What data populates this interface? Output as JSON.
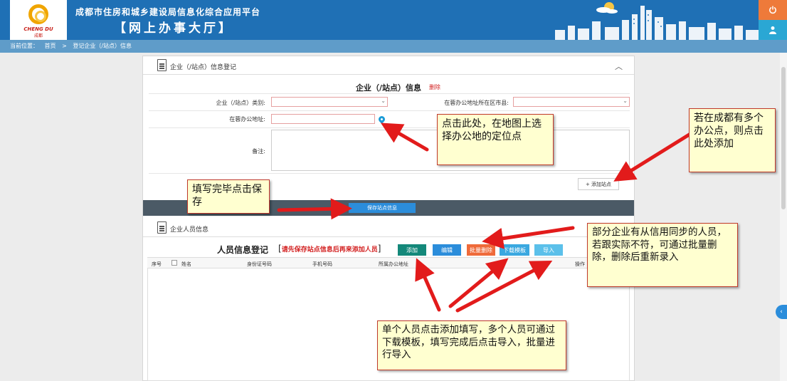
{
  "header": {
    "logo_en": "CHENG DU",
    "logo_cn": "成都",
    "title_line1": "成都市住房和城乡建设局信息化综合应用平台",
    "title_line2": "【网上办事大厅】"
  },
  "breadcrumb": {
    "prefix": "当前位置：",
    "home": "首页",
    "separator": ">",
    "current": "登记企业（/站点）信息"
  },
  "site_section": {
    "heading": "企业（/站点）信息登记",
    "form_title": "企业（/站点）信息",
    "delete_label": "删除",
    "type_label": "企业（/站点）类别:",
    "district_label": "在蓉办公地址所在区市县:",
    "address_label": "在蓉办公地址:",
    "remark_label": "备注:",
    "add_site_label": "+ 添加站点",
    "save_label": "保存站点信息"
  },
  "staff_section": {
    "heading": "企业人员信息",
    "title": "人员信息登记",
    "note_open": "[",
    "note_text": "请先保存站点信息后再来添加人员",
    "note_close": "]",
    "buttons": {
      "add": "添加",
      "edit": "编辑",
      "batch_delete": "批量删除",
      "download_template": "下载模板",
      "import": "导入"
    },
    "columns": {
      "index": "序号",
      "name": "姓名",
      "id_number": "身份证号码",
      "phone": "手机号码",
      "office_address": "所属办公地址",
      "action": "操作"
    }
  },
  "annotations": {
    "map_tip": "点击此处，在地图上选择办公地的定位点",
    "add_site_tip": "若在成都有多个办公点，则点击此处添加",
    "save_tip": "填写完毕点击保存",
    "sync_tip": "部分企业有从信用同步的人员，若跟实际不符，可通过批量删除，删除后重新录入",
    "staff_tip": "单个人员点击添加填写，多个人员可通过下载模板，填写完成后点击导入，批量进行导入"
  },
  "colors": {
    "header_blue": "#1f70b5",
    "breadcrumb_blue": "#5f9cc9",
    "add_green": "#14887a",
    "edit_blue": "#2b8ddb",
    "batch_delete_orange": "#ef6a3a",
    "annotation_bg": "#ffffd0",
    "arrow_red": "#e21b1b"
  },
  "icons": {
    "power": "power-icon",
    "user": "user-icon",
    "document": "document-icon",
    "collapse": "chevron-up-icon",
    "location": "map-pin-icon"
  }
}
